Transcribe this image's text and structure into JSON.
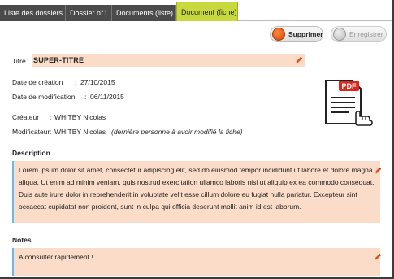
{
  "tabs": [
    {
      "label": "Liste des dossiers"
    },
    {
      "label": "Dossier n°1"
    },
    {
      "label": "Documents (liste)"
    },
    {
      "label": "Document (fiche)"
    }
  ],
  "toolbar": {
    "delete_label": "Supprimer",
    "save_label": "Enregistrer"
  },
  "document": {
    "title_label": "Titre",
    "title_value": "SUPER-TITRE",
    "created_label": "Date de création",
    "created_value": "27/10/2015",
    "modified_label": "Date de modification",
    "modified_value": "06/11/2015",
    "creator_label": "Créateur",
    "creator_value": "WHITBY Nicolas",
    "modifier_label": "Modificateur",
    "modifier_value": "WHITBY Nicolas",
    "modifier_note": "(dernière personne à avoir modifié la fiche)",
    "separator": ":",
    "pdf_badge": "PDF"
  },
  "description": {
    "heading": "Description",
    "text": "Lorem ipsum dolor sit amet, consectetur adipiscing elit, sed do eiusmod tempor incididunt ut labore et dolore magna aliqua. Ut enim ad minim veniam, quis nostrud exercitation ullamco laboris nisi ut aliquip ex ea commodo consequat. Duis aute irure dolor in reprehenderit in voluptate velit esse cillum dolore eu fugiat nulla pariatur. Excepteur sint occaecat cupidatat non proident, sunt in culpa qui officia deserunt mollit anim id est laborum."
  },
  "notes": {
    "heading": "Notes",
    "text": "A consulter rapidement !"
  },
  "colors": {
    "tab_bg": "#4b4b4b",
    "tab_active_bg": "#c7d93c",
    "field_bg": "#fbdcc8",
    "delete_accent": "#e05a14",
    "edit_accent": "#e0521c",
    "textbox_border": "#6fb7e6"
  },
  "icons": {
    "delete": "orange-dot-icon",
    "save": "grey-dot-icon",
    "edit": "pencil-icon",
    "document": "pdf-document-icon",
    "hand": "pointing-hand-icon"
  }
}
